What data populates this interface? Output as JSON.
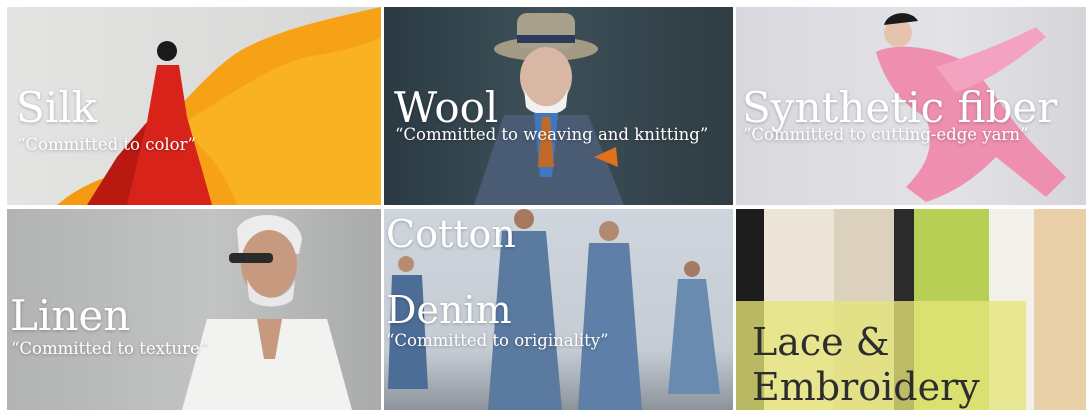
{
  "tiles": {
    "silk": {
      "title": "Silk",
      "tagline": "“Committed to color”"
    },
    "wool": {
      "title": "Wool",
      "tagline": "“Committed to weaving and knitting”"
    },
    "synthetic": {
      "title": "Synthetic fiber",
      "tagline": "“Committed to cutting-edge yarn”"
    },
    "linen": {
      "title": "Linen",
      "tagline": "“Committed to texture”"
    },
    "cotton": {
      "title": "Cotton",
      "subtitle": "Denim",
      "tagline": "“Committed to originality”"
    },
    "lace": {
      "title_line1": "Lace &",
      "title_line2": "Embroidery"
    }
  },
  "colors": {
    "silk_dress": "#d8231a",
    "silk_fabric": "#f6a116",
    "wool_bg": "#2f3c44",
    "synthetic_suit": "#ee8fb0",
    "linen_bg": "#bdbfbf",
    "cotton_denim": "#5d7fa8",
    "lace_overlay": "#e6e678"
  }
}
